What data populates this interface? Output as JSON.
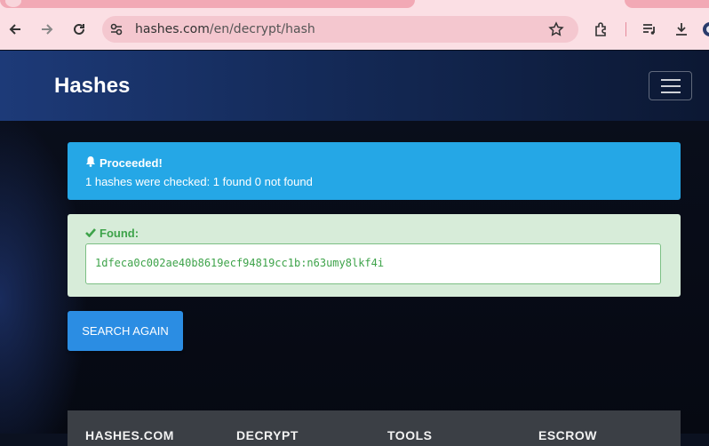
{
  "browser": {
    "url_domain": "hashes.com",
    "url_path": "/en/decrypt/hash"
  },
  "navbar": {
    "brand": "Hashes"
  },
  "info_alert": {
    "title": "Proceeded!",
    "message": "1 hashes were checked: 1 found 0 not found"
  },
  "success_alert": {
    "title": "Found:",
    "result": "1dfeca0c002ae40b8619ecf94819cc1b:n63umy8lkf4i"
  },
  "search_again_button": "SEARCH AGAIN",
  "footer": {
    "columns": [
      "HASHES.COM",
      "DECRYPT",
      "TOOLS",
      "ESCROW"
    ]
  },
  "colors": {
    "info": "#25a7e6",
    "success_bg": "#d7ecd9",
    "success_text": "#3ea34a",
    "button": "#2b8de3"
  }
}
